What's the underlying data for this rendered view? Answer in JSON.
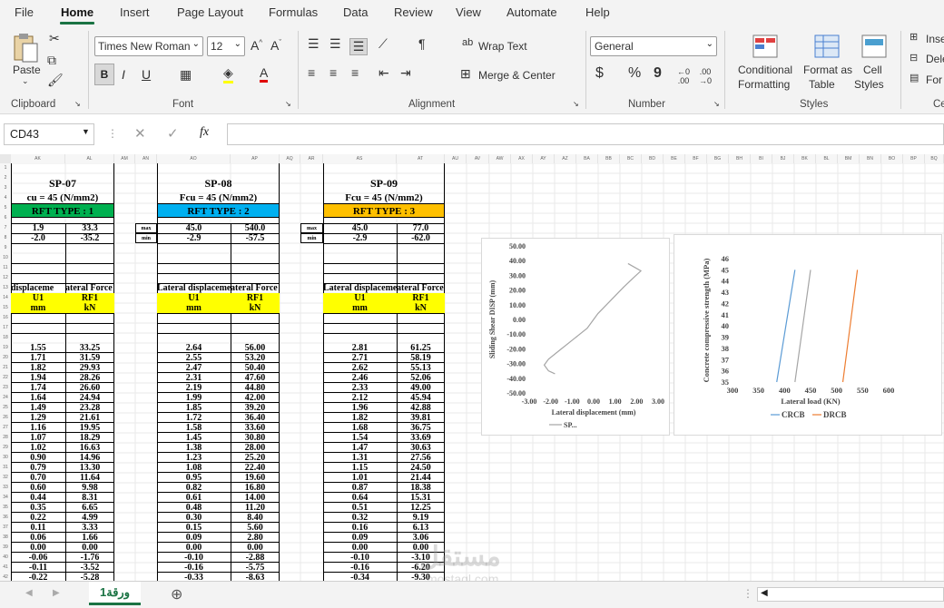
{
  "menu": {
    "items": [
      "File",
      "Home",
      "Insert",
      "Page Layout",
      "Formulas",
      "Data",
      "Review",
      "View",
      "Automate",
      "Help"
    ]
  },
  "ribbon": {
    "clipboard": {
      "paste": "Paste",
      "label": "Clipboard"
    },
    "font": {
      "name": "Times New Roman",
      "size": "12",
      "label": "Font",
      "bold": "B",
      "italic": "I",
      "underline": "U"
    },
    "alignment": {
      "wrap": "Wrap Text",
      "merge": "Merge & Center",
      "label": "Alignment"
    },
    "number": {
      "format": "General",
      "label": "Number",
      "currency": "$",
      "percent": "%",
      "comma": "9"
    },
    "styles": {
      "conditional": "Conditional",
      "conditional2": "Formatting",
      "format_as": "Format as",
      "format_as2": "Table",
      "cell_styles": "Cell",
      "cell_styles2": "Styles",
      "label": "Styles"
    },
    "cells": {
      "insert": "Inse",
      "delete": "Dele",
      "format": "For",
      "label": "Ce"
    }
  },
  "formula_bar": {
    "name_box": "CD43",
    "fx": "fx"
  },
  "columns": [
    "AK",
    "AL",
    "AM",
    "AN",
    "AO",
    "AP",
    "AQ",
    "AR",
    "AS",
    "AT",
    "AU",
    "AV",
    "AW",
    "AX",
    "AY",
    "AZ",
    "BA",
    "BB",
    "BC",
    "BD",
    "BE",
    "BF",
    "BG",
    "BH",
    "BI",
    "BJ",
    "BK",
    "BL",
    "BM",
    "BN",
    "BO",
    "BP",
    "BQ"
  ],
  "rows": [
    "1",
    "2",
    "3",
    "4",
    "5",
    "6",
    "7",
    "8",
    "9",
    "10",
    "11",
    "12",
    "13",
    "14",
    "15",
    "16",
    "17",
    "18",
    "19",
    "20",
    "21",
    "22",
    "23",
    "24",
    "25",
    "26",
    "27",
    "28",
    "29",
    "30",
    "31",
    "32",
    "33",
    "34",
    "35",
    "36",
    "37",
    "38",
    "39",
    "40",
    "41",
    "42",
    "43",
    "44"
  ],
  "labels": {
    "max": "max",
    "min": "min"
  },
  "specimens": [
    {
      "title": "SP-07",
      "fcu": "cu = 45  (N/mm2)",
      "rft": "RFT TYPE :  1",
      "rft_color": "#00b050",
      "max": [
        "1.9",
        "33.3"
      ],
      "min": [
        "-2.0",
        "-35.2"
      ],
      "h1": "displaceme",
      "h2": "ateral Force",
      "u1": "U1",
      "rf1": "RF1",
      "mm": "mm",
      "kn": "kN",
      "data": [
        [
          "1.55",
          "33.25"
        ],
        [
          "1.71",
          "31.59"
        ],
        [
          "1.82",
          "29.93"
        ],
        [
          "1.94",
          "28.26"
        ],
        [
          "1.74",
          "26.60"
        ],
        [
          "1.64",
          "24.94"
        ],
        [
          "1.49",
          "23.28"
        ],
        [
          "1.29",
          "21.61"
        ],
        [
          "1.16",
          "19.95"
        ],
        [
          "1.07",
          "18.29"
        ],
        [
          "1.02",
          "16.63"
        ],
        [
          "0.90",
          "14.96"
        ],
        [
          "0.79",
          "13.30"
        ],
        [
          "0.70",
          "11.64"
        ],
        [
          "0.60",
          "9.98"
        ],
        [
          "0.44",
          "8.31"
        ],
        [
          "0.35",
          "6.65"
        ],
        [
          "0.22",
          "4.99"
        ],
        [
          "0.11",
          "3.33"
        ],
        [
          "0.06",
          "1.66"
        ],
        [
          "0.00",
          "0.00"
        ],
        [
          "-0.06",
          "-1.76"
        ],
        [
          "-0.11",
          "-3.52"
        ],
        [
          "-0.22",
          "-5.28"
        ]
      ]
    },
    {
      "title": "SP-08",
      "fcu": "Fcu = 45  (N/mm2)",
      "rft": "RFT TYPE :  2",
      "rft_color": "#00b0f0",
      "max": [
        "45.0",
        "540.0"
      ],
      "min": [
        "-2.9",
        "-57.5"
      ],
      "h1": "Lateral displaceme",
      "h2": "ateral Force",
      "u1": "U1",
      "rf1": "RF1",
      "mm": "mm",
      "kn": "kN",
      "data": [
        [
          "2.64",
          "56.00"
        ],
        [
          "2.55",
          "53.20"
        ],
        [
          "2.47",
          "50.40"
        ],
        [
          "2.31",
          "47.60"
        ],
        [
          "2.19",
          "44.80"
        ],
        [
          "1.99",
          "42.00"
        ],
        [
          "1.85",
          "39.20"
        ],
        [
          "1.72",
          "36.40"
        ],
        [
          "1.58",
          "33.60"
        ],
        [
          "1.45",
          "30.80"
        ],
        [
          "1.38",
          "28.00"
        ],
        [
          "1.23",
          "25.20"
        ],
        [
          "1.08",
          "22.40"
        ],
        [
          "0.95",
          "19.60"
        ],
        [
          "0.82",
          "16.80"
        ],
        [
          "0.61",
          "14.00"
        ],
        [
          "0.48",
          "11.20"
        ],
        [
          "0.30",
          "8.40"
        ],
        [
          "0.15",
          "5.60"
        ],
        [
          "0.09",
          "2.80"
        ],
        [
          "0.00",
          "0.00"
        ],
        [
          "-0.10",
          "-2.88"
        ],
        [
          "-0.16",
          "-5.75"
        ],
        [
          "-0.33",
          "-8.63"
        ]
      ]
    },
    {
      "title": "SP-09",
      "fcu": "Fcu = 45  (N/mm2)",
      "rft": "RFT TYPE :  3",
      "rft_color": "#ffc000",
      "max": [
        "45.0",
        "77.0"
      ],
      "min": [
        "-2.9",
        "-62.0"
      ],
      "h1": "Lateral displaceme",
      "h2": "ateral Force",
      "u1": "U1",
      "rf1": "RF1",
      "mm": "mm",
      "kn": "kN",
      "data": [
        [
          "2.81",
          "61.25"
        ],
        [
          "2.71",
          "58.19"
        ],
        [
          "2.62",
          "55.13"
        ],
        [
          "2.46",
          "52.06"
        ],
        [
          "2.33",
          "49.00"
        ],
        [
          "2.12",
          "45.94"
        ],
        [
          "1.96",
          "42.88"
        ],
        [
          "1.82",
          "39.81"
        ],
        [
          "1.68",
          "36.75"
        ],
        [
          "1.54",
          "33.69"
        ],
        [
          "1.47",
          "30.63"
        ],
        [
          "1.31",
          "27.56"
        ],
        [
          "1.15",
          "24.50"
        ],
        [
          "1.01",
          "21.44"
        ],
        [
          "0.87",
          "18.38"
        ],
        [
          "0.64",
          "15.31"
        ],
        [
          "0.51",
          "12.25"
        ],
        [
          "0.32",
          "9.19"
        ],
        [
          "0.16",
          "6.13"
        ],
        [
          "0.09",
          "3.06"
        ],
        [
          "0.00",
          "0.00"
        ],
        [
          "-0.10",
          "-3.10"
        ],
        [
          "-0.16",
          "-6.20"
        ],
        [
          "-0.34",
          "-9.30"
        ]
      ]
    }
  ],
  "chart_data": [
    {
      "type": "line",
      "xlabel": "Lateral displacement (mm)",
      "ylabel": "Sliding Shear  DISP (mm)",
      "xlim": [
        -3,
        3
      ],
      "ylim": [
        -50,
        50
      ],
      "xticks": [
        "-3.00",
        "-2.00",
        "-1.00",
        "0.00",
        "1.00",
        "2.00",
        "3.00"
      ],
      "yticks": [
        "50.00",
        "40.00",
        "30.00",
        "20.00",
        "10.00",
        "0.00",
        "-10.00",
        "-20.00",
        "-30.00",
        "-40.00",
        "-50.00"
      ],
      "legend": "SP...",
      "color": "#a5a5a5",
      "series": [
        {
          "name": "SP...",
          "x": [
            1.6,
            2.2,
            1.9,
            1.4,
            1.0,
            0.6,
            0.2,
            0.0,
            -0.3,
            -0.9,
            -1.5,
            -2.1,
            -2.3,
            -2.1,
            -1.8
          ],
          "y": [
            38,
            33,
            29,
            22,
            16,
            10,
            4,
            0,
            -6,
            -13,
            -20,
            -27,
            -31,
            -35,
            -37
          ]
        }
      ]
    },
    {
      "type": "line",
      "xlabel": "Lateral load (KN)",
      "ylabel": "Concrete compressive strength (MPa)",
      "xlim": [
        300,
        600
      ],
      "ylim": [
        35,
        46
      ],
      "xticks": [
        "300",
        "350",
        "400",
        "450",
        "500",
        "550",
        "600"
      ],
      "yticks": [
        "46",
        "45",
        "44",
        "43",
        "42",
        "41",
        "40",
        "39",
        "38",
        "37",
        "36",
        "35"
      ],
      "series": [
        {
          "name": "CRCB",
          "color": "#5b9bd5",
          "x": [
            385,
            420
          ],
          "y": [
            35,
            45
          ]
        },
        {
          "name": "",
          "color": "#a5a5a5",
          "x": [
            420,
            450
          ],
          "y": [
            35,
            45
          ]
        },
        {
          "name": "DRCB",
          "color": "#ed7d31",
          "x": [
            512,
            540
          ],
          "y": [
            35,
            45
          ]
        }
      ]
    }
  ],
  "sheet_tab": "ورقة1"
}
